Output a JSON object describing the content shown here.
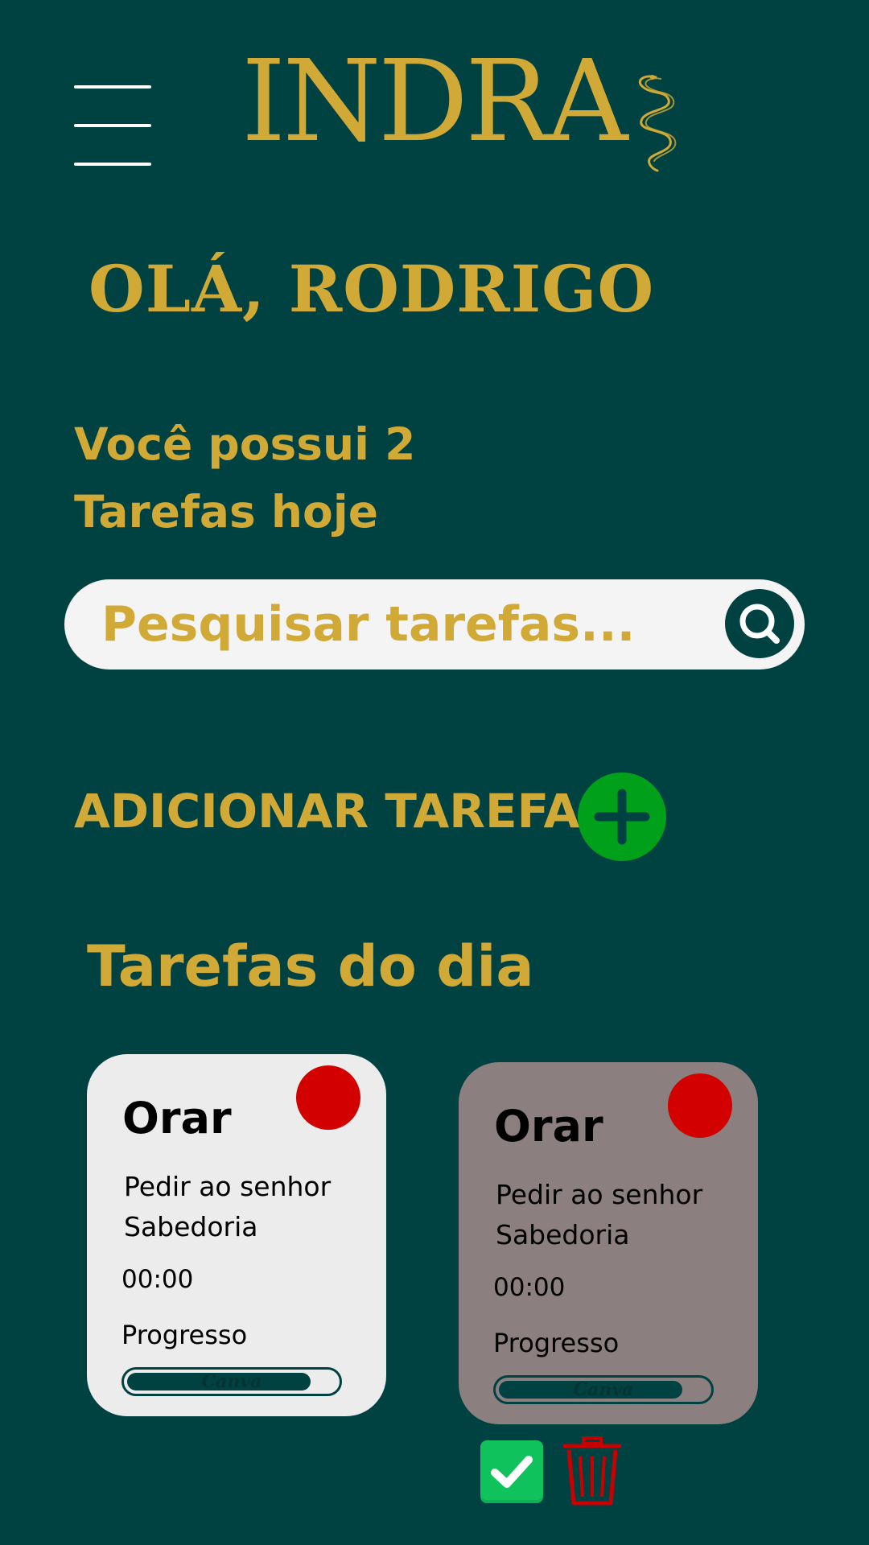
{
  "header": {
    "logo_text": "INDRA",
    "menu_icon": "hamburger-menu-icon",
    "logo_icon": "snake-icon"
  },
  "greeting": "OLÁ, RODRIGO",
  "summary": {
    "line1": "Você possui 2",
    "line2": "Tarefas hoje"
  },
  "search": {
    "placeholder": "Pesquisar tarefas...",
    "icon": "search-icon"
  },
  "add_task": {
    "label": "ADICIONAR TAREFA",
    "icon": "plus-icon"
  },
  "section_title": "Tarefas do dia",
  "tasks": [
    {
      "title": "Orar",
      "description": "Pedir ao senhor Sabedoria",
      "time": "00:00",
      "progress_label": "Progresso",
      "progress": 0.87,
      "progress_watermark": "Canva",
      "status_color": "#D30000",
      "card_color": "#EDECEC"
    },
    {
      "title": "Orar",
      "description": "Pedir ao senhor Sabedoria",
      "time": "00:00",
      "progress_label": "Progresso",
      "progress": 0.87,
      "progress_watermark": "Canva",
      "status_color": "#D30000",
      "card_color": "#8B7F7F"
    }
  ],
  "actions": {
    "complete_icon": "checkmark-icon",
    "delete_icon": "trash-icon"
  },
  "colors": {
    "background": "#004141",
    "accent": "#D1A937",
    "add": "#00A01A",
    "status": "#D30000",
    "complete": "#0FC25C",
    "delete": "#C80000"
  }
}
